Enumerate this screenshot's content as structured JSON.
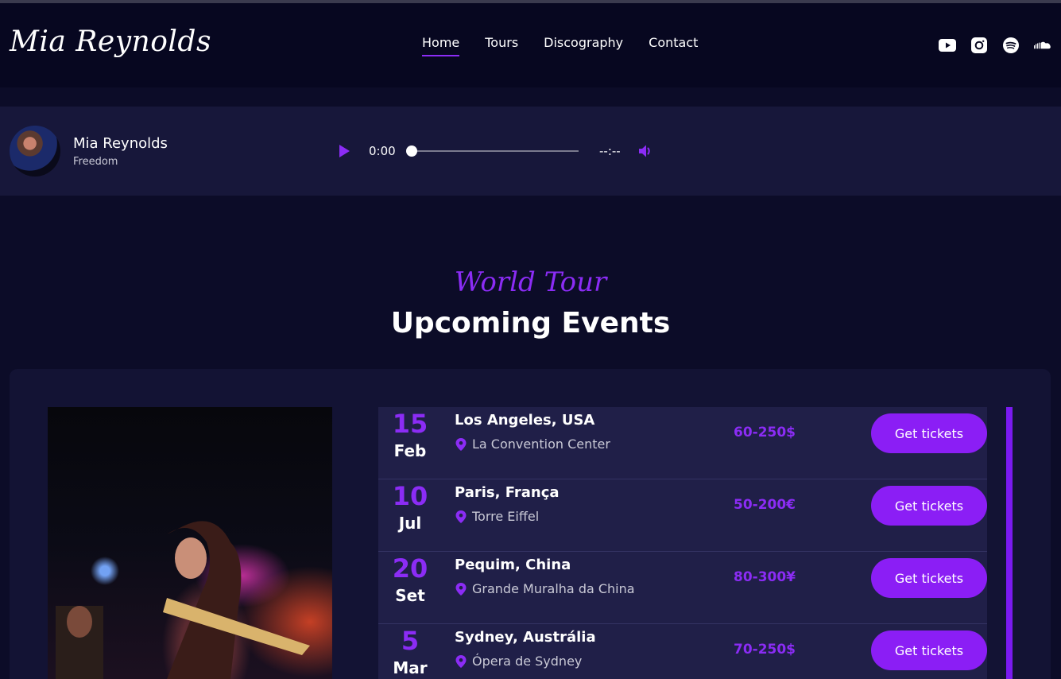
{
  "header": {
    "logo": "Mia Reynolds",
    "nav": [
      {
        "label": "Home",
        "active": true
      },
      {
        "label": "Tours",
        "active": false
      },
      {
        "label": "Discography",
        "active": false
      },
      {
        "label": "Contact",
        "active": false
      }
    ],
    "social_icons": [
      "youtube-icon",
      "instagram-icon",
      "spotify-icon",
      "soundcloud-icon"
    ]
  },
  "player": {
    "artist": "Mia Reynolds",
    "track": "Freedom",
    "current_time": "0:00",
    "duration": "--:--",
    "progress": 0
  },
  "section": {
    "kicker": "World Tour",
    "title": "Upcoming Events"
  },
  "events": [
    {
      "day": "15",
      "month": "Feb",
      "city": "Los Angeles, USA",
      "venue": "La Convention Center",
      "price": "60-250$",
      "button": "Get tickets"
    },
    {
      "day": "10",
      "month": "Jul",
      "city": "Paris, França",
      "venue": "Torre Eiffel",
      "price": "50-200€",
      "button": "Get tickets"
    },
    {
      "day": "20",
      "month": "Set",
      "city": "Pequim, China",
      "venue": "Grande Muralha da China",
      "price": "80-300¥",
      "button": "Get tickets"
    },
    {
      "day": "5",
      "month": "Mar",
      "city": "Sydney, Austrália",
      "venue": "Ópera de Sydney",
      "price": "70-250$",
      "button": "Get tickets"
    }
  ],
  "colors": {
    "accent": "#8b2cf5",
    "background": "#0c0c28",
    "header_bg": "#070720",
    "card_bg": "#201f48"
  }
}
